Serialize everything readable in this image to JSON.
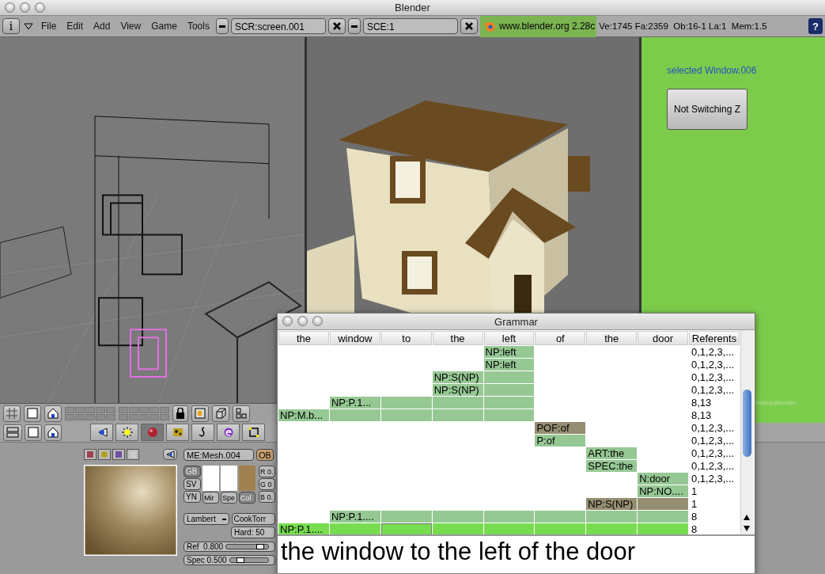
{
  "window": {
    "title": "Blender"
  },
  "menu_bar": {
    "menus": [
      "File",
      "Edit",
      "Add",
      "View",
      "Game",
      "Tools"
    ],
    "screen_field": "SCR:screen.001",
    "scene_field": "SCE:1",
    "version_link": "www.blender.org 2.28c",
    "stats": "Ve:1745 Fa:2359  Ob:16-1 La:1  Mem:1.5",
    "info_icon": "i",
    "help_icon": "?"
  },
  "logic_panel": {
    "label": "selected Window.006",
    "button": "Not Switching Z",
    "credit": "bishopjblender"
  },
  "button_tabs": [
    {
      "selected": false
    },
    {
      "selected": false
    },
    {
      "selected": true
    },
    {
      "selected": false
    },
    {
      "selected": false
    },
    {
      "selected": false
    },
    {
      "selected": false
    }
  ],
  "material_panel": {
    "mesh_field": "ME:Mesh.004",
    "ob_button": "OB",
    "mode_buttons": [
      {
        "label": "GB",
        "selected": true
      },
      {
        "label": "SV",
        "selected": false
      },
      {
        "label": "YN",
        "selected": false
      }
    ],
    "color_buttons": [
      {
        "label": "Mir",
        "color": "#ffffff",
        "selected": false
      },
      {
        "label": "Spe",
        "color": "#ffffff",
        "selected": false
      },
      {
        "label": "Col",
        "color": "#a08050",
        "selected": true
      }
    ],
    "rgb": [
      "R 0.",
      "G 0",
      "B 0."
    ],
    "diffuse": "Lambert",
    "specular": "CookTorr",
    "hardness": "Hard: 50",
    "sliders": [
      {
        "label": "Ref  0.800",
        "level": 0.8
      },
      {
        "label": "Spec 0.500",
        "level": 0.25
      }
    ]
  },
  "grammar_window": {
    "title": "Grammar",
    "columns": [
      "the",
      "window",
      "to",
      "the",
      "left",
      "of",
      "the",
      "door",
      "Referents"
    ],
    "rows": [
      {
        "cells": [
          {
            "kind": "blank"
          },
          {
            "kind": "blank"
          },
          {
            "kind": "blank"
          },
          {
            "kind": "blank"
          },
          {
            "kind": "node",
            "label": "NP:left"
          },
          {
            "kind": "blank"
          },
          {
            "kind": "blank"
          },
          {
            "kind": "blank"
          }
        ],
        "referents": "0,1,2,3,..."
      },
      {
        "cells": [
          {
            "kind": "blank"
          },
          {
            "kind": "blank"
          },
          {
            "kind": "blank"
          },
          {
            "kind": "blank"
          },
          {
            "kind": "node",
            "label": "NP:left"
          },
          {
            "kind": "blank"
          },
          {
            "kind": "blank"
          },
          {
            "kind": "blank"
          }
        ],
        "referents": "0,1,2,3,..."
      },
      {
        "cells": [
          {
            "kind": "blank"
          },
          {
            "kind": "blank"
          },
          {
            "kind": "blank"
          },
          {
            "kind": "node",
            "label": "NP:S(NP)"
          },
          {
            "kind": "node"
          },
          {
            "kind": "blank"
          },
          {
            "kind": "blank"
          },
          {
            "kind": "blank"
          }
        ],
        "referents": "0,1,2,3,..."
      },
      {
        "cells": [
          {
            "kind": "blank"
          },
          {
            "kind": "blank"
          },
          {
            "kind": "blank"
          },
          {
            "kind": "node",
            "label": "NP:S(NP)"
          },
          {
            "kind": "node"
          },
          {
            "kind": "blank"
          },
          {
            "kind": "blank"
          },
          {
            "kind": "blank"
          }
        ],
        "referents": "0,1,2,3,..."
      },
      {
        "cells": [
          {
            "kind": "blank"
          },
          {
            "kind": "node",
            "label": "NP:P.1..."
          },
          {
            "kind": "node"
          },
          {
            "kind": "node"
          },
          {
            "kind": "node"
          },
          {
            "kind": "blank"
          },
          {
            "kind": "blank"
          },
          {
            "kind": "blank"
          }
        ],
        "referents": "8,13"
      },
      {
        "cells": [
          {
            "kind": "node",
            "label": "NP:M.b..."
          },
          {
            "kind": "node"
          },
          {
            "kind": "node"
          },
          {
            "kind": "node"
          },
          {
            "kind": "node"
          },
          {
            "kind": "blank"
          },
          {
            "kind": "blank"
          },
          {
            "kind": "blank"
          }
        ],
        "referents": "8,13"
      },
      {
        "cells": [
          {
            "kind": "blank"
          },
          {
            "kind": "blank"
          },
          {
            "kind": "blank"
          },
          {
            "kind": "blank"
          },
          {
            "kind": "blank"
          },
          {
            "kind": "dim",
            "label": "POF:of"
          },
          {
            "kind": "blank"
          },
          {
            "kind": "blank"
          }
        ],
        "referents": "0,1,2,3,..."
      },
      {
        "cells": [
          {
            "kind": "blank"
          },
          {
            "kind": "blank"
          },
          {
            "kind": "blank"
          },
          {
            "kind": "blank"
          },
          {
            "kind": "blank"
          },
          {
            "kind": "node",
            "label": "P:of"
          },
          {
            "kind": "blank"
          },
          {
            "kind": "blank"
          }
        ],
        "referents": "0,1,2,3,..."
      },
      {
        "cells": [
          {
            "kind": "blank"
          },
          {
            "kind": "blank"
          },
          {
            "kind": "blank"
          },
          {
            "kind": "blank"
          },
          {
            "kind": "blank"
          },
          {
            "kind": "blank"
          },
          {
            "kind": "node",
            "label": "ART:the"
          },
          {
            "kind": "blank"
          }
        ],
        "referents": "0,1,2,3,..."
      },
      {
        "cells": [
          {
            "kind": "blank"
          },
          {
            "kind": "blank"
          },
          {
            "kind": "blank"
          },
          {
            "kind": "blank"
          },
          {
            "kind": "blank"
          },
          {
            "kind": "blank"
          },
          {
            "kind": "node",
            "label": "SPEC:the"
          },
          {
            "kind": "blank"
          }
        ],
        "referents": "0,1,2,3,..."
      },
      {
        "cells": [
          {
            "kind": "blank"
          },
          {
            "kind": "blank"
          },
          {
            "kind": "blank"
          },
          {
            "kind": "blank"
          },
          {
            "kind": "blank"
          },
          {
            "kind": "blank"
          },
          {
            "kind": "blank"
          },
          {
            "kind": "node",
            "label": "N:door"
          }
        ],
        "referents": "0,1,2,3,..."
      },
      {
        "cells": [
          {
            "kind": "blank"
          },
          {
            "kind": "blank"
          },
          {
            "kind": "blank"
          },
          {
            "kind": "blank"
          },
          {
            "kind": "blank"
          },
          {
            "kind": "blank"
          },
          {
            "kind": "blank"
          },
          {
            "kind": "node",
            "label": "NP:NO...."
          }
        ],
        "referents": "1"
      },
      {
        "cells": [
          {
            "kind": "blank"
          },
          {
            "kind": "blank"
          },
          {
            "kind": "blank"
          },
          {
            "kind": "blank"
          },
          {
            "kind": "blank"
          },
          {
            "kind": "blank"
          },
          {
            "kind": "dim",
            "label": "NP:S(NP)"
          },
          {
            "kind": "dim"
          }
        ],
        "referents": "1"
      },
      {
        "cells": [
          {
            "kind": "blank"
          },
          {
            "kind": "node",
            "label": "NP:P.1...."
          },
          {
            "kind": "node"
          },
          {
            "kind": "node"
          },
          {
            "kind": "node"
          },
          {
            "kind": "node"
          },
          {
            "kind": "node"
          },
          {
            "kind": "node"
          }
        ],
        "referents": "8"
      },
      {
        "cells": [
          {
            "kind": "active",
            "label": "NP:P.1...."
          },
          {
            "kind": "active"
          },
          {
            "kind": "focused"
          },
          {
            "kind": "active"
          },
          {
            "kind": "active"
          },
          {
            "kind": "active"
          },
          {
            "kind": "active"
          },
          {
            "kind": "active"
          }
        ],
        "referents": "8"
      }
    ],
    "sentence": "the window to the left of the door"
  }
}
